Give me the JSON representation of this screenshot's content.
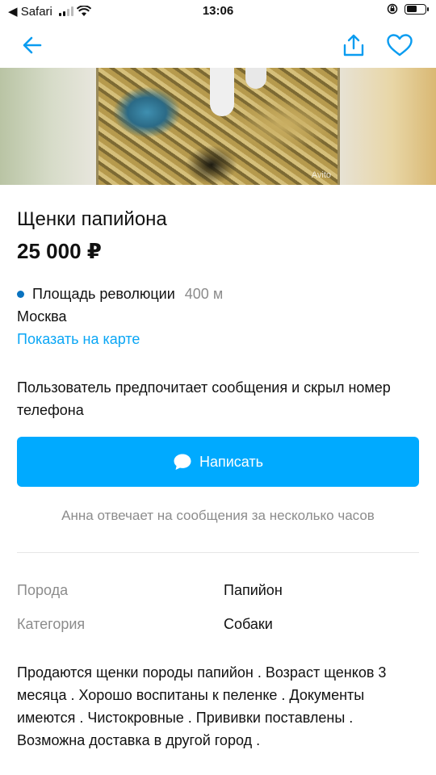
{
  "status_bar": {
    "back_app_label": "◀ Safari",
    "time": "13:06"
  },
  "nav": {
    "back_icon": "arrow-left-icon",
    "share_icon": "share-icon",
    "favorite_icon": "heart-icon",
    "accent_color": "#0a9cf0"
  },
  "gallery": {
    "watermark": "Avito"
  },
  "listing": {
    "title": "Щенки папийона",
    "price": "25 000 ₽",
    "metro_station": "Площадь революции",
    "metro_distance": "400 м",
    "metro_color": "#0a73c0",
    "city": "Москва",
    "map_link": "Показать на карте",
    "contact_notice": "Пользователь предпочитает сообщения и скрыл номер телефона",
    "write_button": "Написать",
    "write_button_color": "#00aaff",
    "reply_note": "Анна отвечает на сообщения за несколько часов"
  },
  "params": [
    {
      "name": "Порода",
      "value": "Папийон"
    },
    {
      "name": "Категория",
      "value": "Собаки"
    }
  ],
  "description": "Продаются щенки породы папийон . Возраст щенков 3 месяца . Хорошо воспитаны к пеленке . Документы имеются . Чистокровные . Прививки поставлены . Возможна доставка в другой город ."
}
